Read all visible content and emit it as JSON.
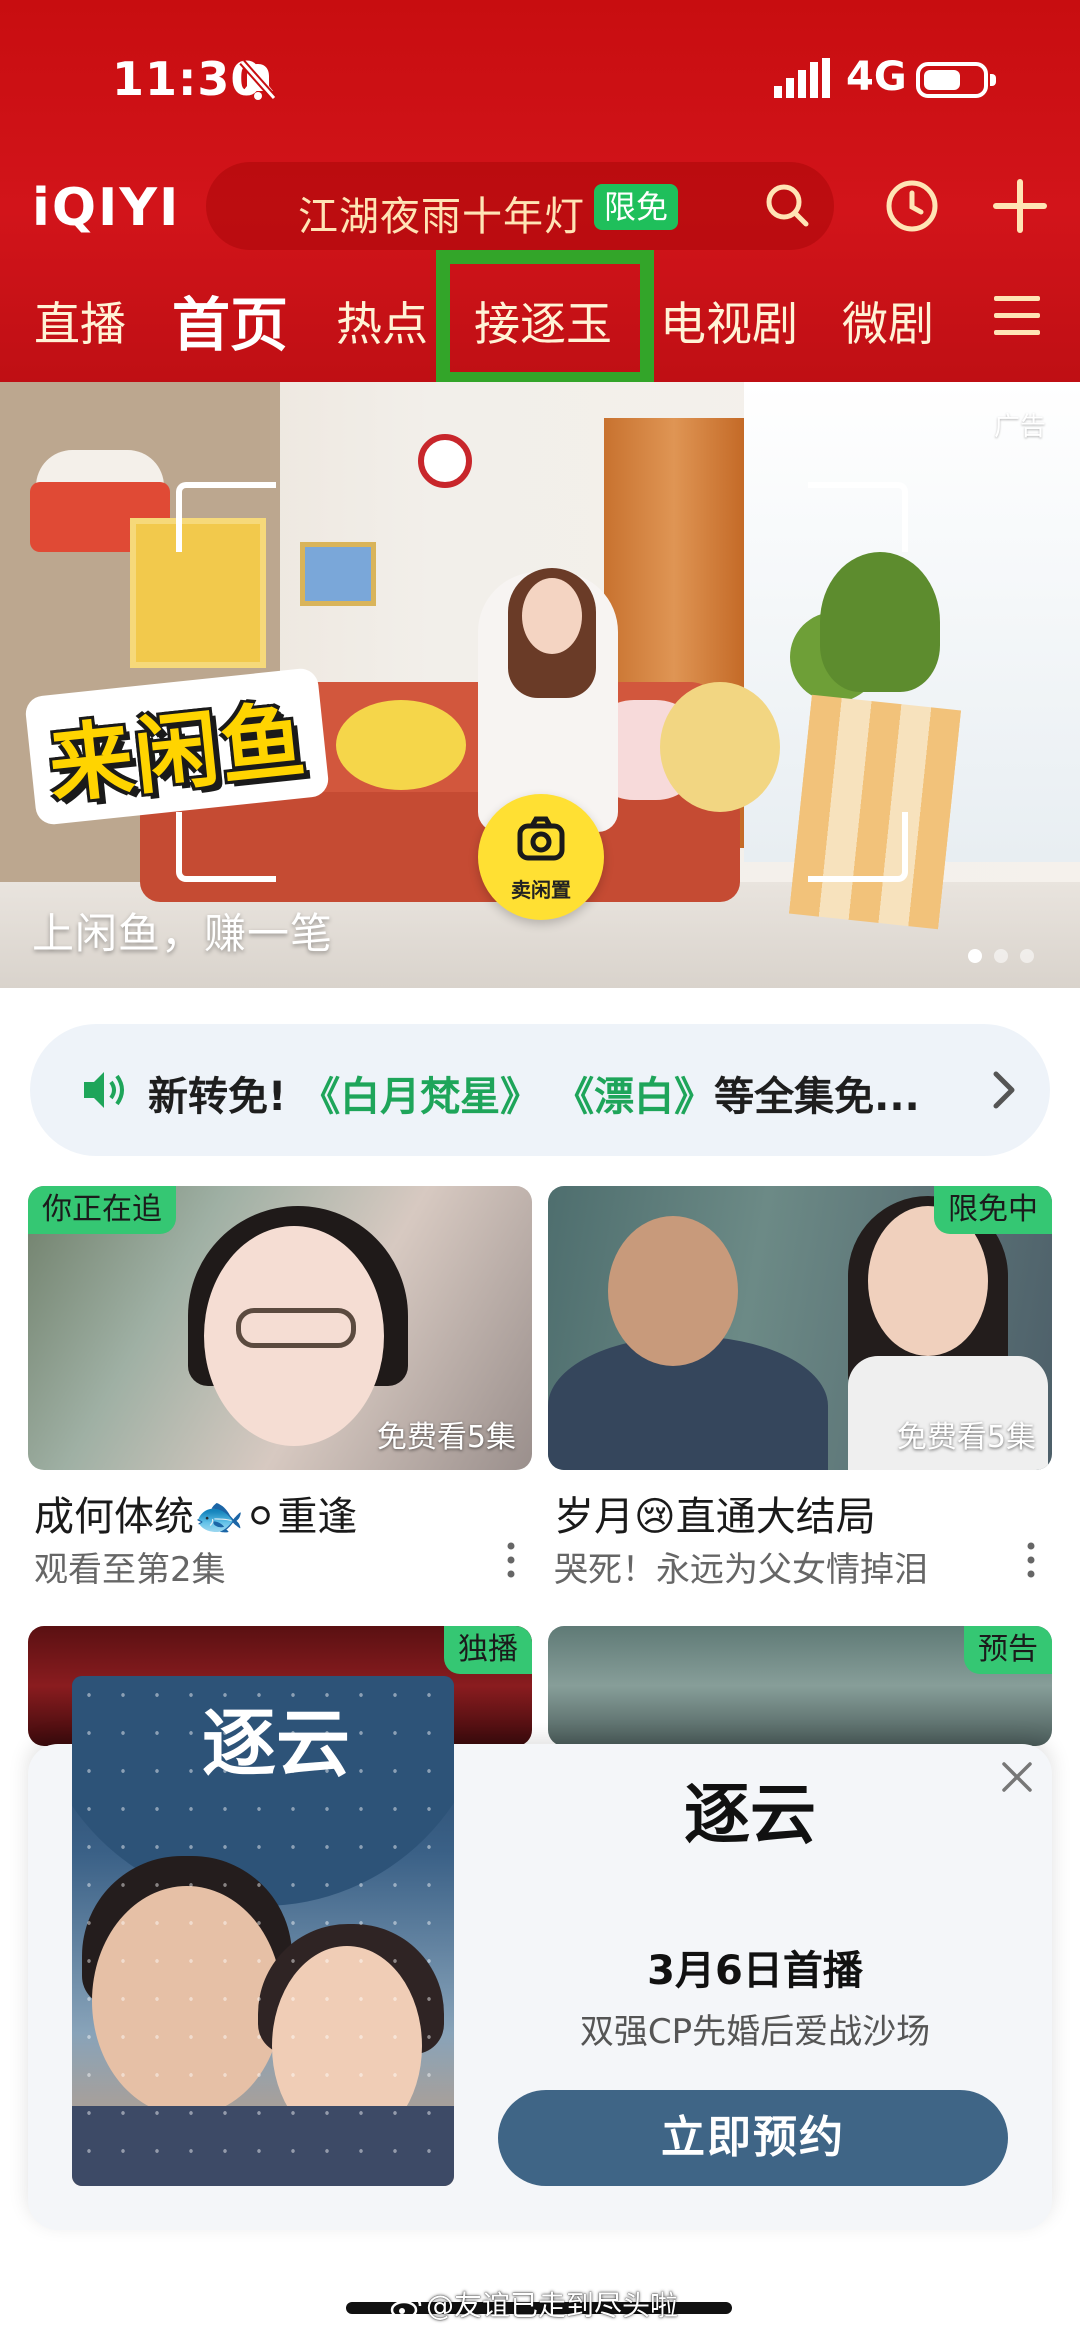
{
  "status_bar": {
    "time": "11:30",
    "network": "4G"
  },
  "header": {
    "logo": "iQIYI",
    "search_query": "江湖夜雨十年灯",
    "search_badge": "限免"
  },
  "nav_tabs": [
    "直播",
    "首页",
    "热点",
    "接逐玉",
    "电视剧",
    "微剧"
  ],
  "banner": {
    "ad_label": "广告",
    "brand": "来闲鱼",
    "camera_label": "卖闲置",
    "slogan": "上闲鱼，赚一笔"
  },
  "notice": {
    "prefix": "新转免!",
    "highlight1": "《白月梵星》",
    "highlight2": "《漂白》",
    "suffix": "等全集免..."
  },
  "cards": [
    {
      "tag": "你正在追",
      "episodes": "免费看5集",
      "title": "成何体统🐟⚪重逢",
      "subtitle": "观看至第2集"
    },
    {
      "tag": "限免中",
      "episodes": "免费看5集",
      "title": "岁月😢直通大结局",
      "subtitle": "哭死！永远为父女情掉泪"
    },
    {
      "tag": "独播"
    },
    {
      "tag": "预告"
    }
  ],
  "popup": {
    "poster_title": "逐云",
    "logo_text": "逐云",
    "premiere": "3月6日首播",
    "description": "双强CP先婚后爱战沙场",
    "button": "立即预约"
  },
  "watermark": "@友谊已走到尽头啦",
  "colors": {
    "header_red": "#c80d10",
    "badge_green": "#1fbf5b",
    "tag_green": "#35c773",
    "highlight_green": "#1ea55a",
    "button_blue": "#3f6586",
    "annotation_box": "#33a529"
  }
}
